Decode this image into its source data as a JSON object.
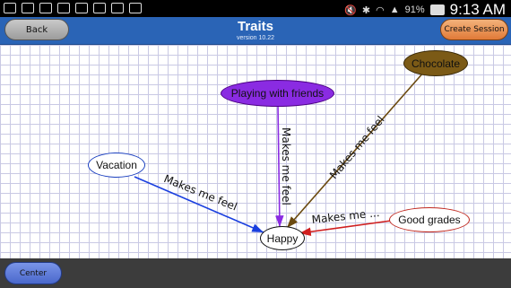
{
  "header": {
    "title": "Traits",
    "version": "version 10.22",
    "back_label": "Back",
    "create_session_label": "Create Session"
  },
  "status_bar": {
    "battery_percent": "91%",
    "time": "9:13 AM"
  },
  "diagram": {
    "nodes": {
      "chocolate": {
        "label": "Chocolate",
        "fill": "#7b5a16",
        "stroke": "#3a2a08"
      },
      "playing": {
        "label": "Playing with friends",
        "fill": "#8a2be2",
        "stroke": "#4b0082"
      },
      "vacation": {
        "label": "Vacation",
        "fill": "#ffffff",
        "stroke": "#1a3fbf"
      },
      "happy": {
        "label": "Happy",
        "fill": "#ffffff",
        "stroke": "#111111"
      },
      "good_grades": {
        "label": "Good grades",
        "fill": "#ffffff",
        "stroke": "#c0281f"
      }
    },
    "edges": {
      "vacation_happy": {
        "label": "Makes me feel",
        "color": "#1a3fdf"
      },
      "playing_happy": {
        "label": "Makes me feel",
        "color": "#8a2be2"
      },
      "chocolate_happy": {
        "label": "Makes me feel",
        "color": "#6b4a10"
      },
      "grades_happy": {
        "label": "Makes me ...",
        "color": "#d01f1f"
      }
    }
  },
  "footer": {
    "center_label": "Center"
  }
}
